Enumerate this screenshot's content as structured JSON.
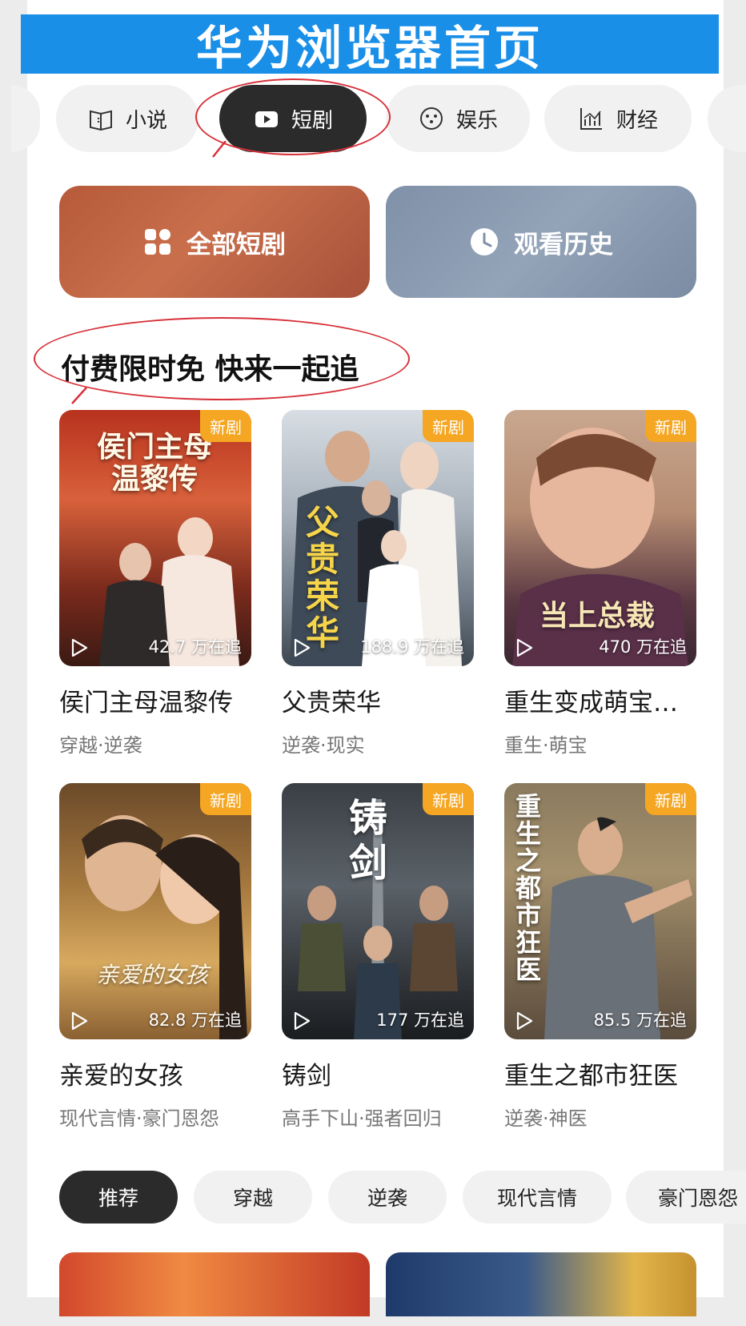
{
  "banner": {
    "title": "华为浏览器首页"
  },
  "top_tabs": [
    {
      "label": "小说",
      "icon": "book-icon",
      "active": false
    },
    {
      "label": "短剧",
      "icon": "video-play-icon",
      "active": true
    },
    {
      "label": "娱乐",
      "icon": "entertainment-icon",
      "active": false
    },
    {
      "label": "财经",
      "icon": "chart-icon",
      "active": false
    }
  ],
  "actions": {
    "all_dramas": "全部短剧",
    "history": "观看历史"
  },
  "section": {
    "title": "付费限时免 快来一起追"
  },
  "dramas": [
    {
      "title": "侯门主母温黎传",
      "tags": "穿越·逆袭",
      "views": "42.7 万在追",
      "badge": "新剧",
      "poster_text": "侯门主母温黎传"
    },
    {
      "title": "父贵荣华",
      "tags": "逆袭·现实",
      "views": "188.9 万在追",
      "badge": "新剧",
      "poster_text": "父贵荣华"
    },
    {
      "title": "重生变成萌宝…",
      "tags": "重生·萌宝",
      "views": "470 万在追",
      "badge": "新剧",
      "poster_text": "当上总裁"
    },
    {
      "title": "亲爱的女孩",
      "tags": "现代言情·豪门恩怨",
      "views": "82.8 万在追",
      "badge": "新剧",
      "poster_text": "亲爱的女孩"
    },
    {
      "title": "铸剑",
      "tags": "高手下山·强者回归",
      "views": "177 万在追",
      "badge": "新剧",
      "poster_text": "铸剑"
    },
    {
      "title": "重生之都市狂医",
      "tags": "逆袭·神医",
      "views": "85.5 万在追",
      "badge": "新剧",
      "poster_text": "重生之都市狂医"
    }
  ],
  "genres": [
    "推荐",
    "穿越",
    "逆袭",
    "现代言情",
    "豪门恩怨"
  ],
  "colors": {
    "banner": "#1a8fe8",
    "active_tab": "#2b2b2b",
    "badge": "#f5a623",
    "annotation": "#d8313a"
  }
}
